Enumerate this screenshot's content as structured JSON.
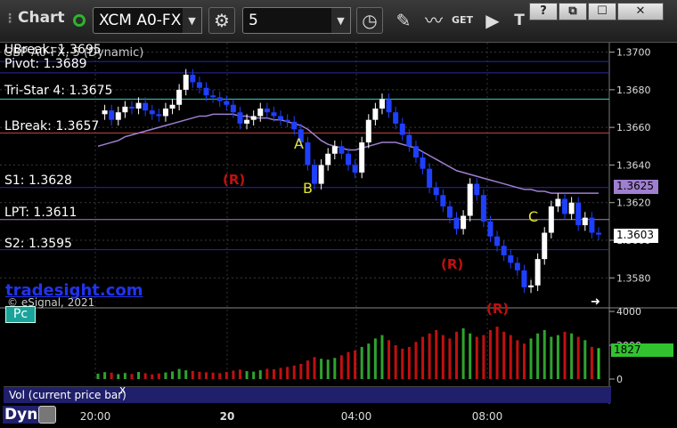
{
  "toolbar": {
    "title": "Chart",
    "symbol": "XCM A0-FX",
    "interval": "5",
    "get_label": "GET",
    "win_help": "?",
    "win_restore": "⧉",
    "win_max": "☐",
    "win_close": "✕",
    "icons": [
      "gear-icon",
      "clock-icon",
      "pencil-icon",
      "drawing-tools-icon",
      "get-data-icon",
      "play-icon",
      "text-tool-icon"
    ]
  },
  "chart": {
    "header_label": "GBP A0-FX, 5 (Dynamic)",
    "brand": "tradesight.com",
    "copyright": "© eSignal, 2021",
    "pc_label": "Pc",
    "vol_caption": "Vol (current price bar)",
    "vol_close": "x",
    "dyn_label": "Dyn",
    "colors": {
      "up_bar": "#ffffff",
      "down_bar": "#1f3fff",
      "ma": "#9f7fd0",
      "pivot_line": "#2a2aa0",
      "tristar_line": "#40d0c0",
      "lbreak_line": "#c04040",
      "vol_up": "#2ea42e",
      "vol_down": "#c01010",
      "vol_last": "#31c22f"
    }
  },
  "levels": [
    {
      "label": "UBreak: 1.3695",
      "value": 1.3695
    },
    {
      "label": "Pivot: 1.3689",
      "value": 1.3689
    },
    {
      "label": "Tri-Star 4: 1.3675",
      "value": 1.3675
    },
    {
      "label": "LBreak: 1.3657",
      "value": 1.3657
    },
    {
      "label": "S1: 1.3628",
      "value": 1.3628
    },
    {
      "label": "LPT: 1.3611",
      "value": 1.3611
    },
    {
      "label": "S2: 1.3595",
      "value": 1.3595
    }
  ],
  "markers": [
    {
      "label": "A",
      "time": "03:00",
      "price": 1.3652
    },
    {
      "label": "B",
      "time": "03:10",
      "price": 1.3625
    },
    {
      "label": "C",
      "time": "08:35",
      "price": 1.3617
    }
  ],
  "r_marks": [
    {
      "label": "(R)",
      "time": "01:15",
      "price": 1.363
    },
    {
      "label": "(R)",
      "time": "06:40",
      "price": 1.3592
    },
    {
      "label": "(R)",
      "time": "07:55",
      "price": 1.3561
    }
  ],
  "current_price": "1.3603",
  "ma_price": "1.3625",
  "current_volume": "1827",
  "chart_data": {
    "type": "line",
    "x_ticks": [
      "20:00",
      "20",
      "04:00",
      "08:00"
    ],
    "price_ticks": [
      "1.3700",
      "1.3680",
      "1.3660",
      "1.3640",
      "1.3620",
      "1.3600",
      "1.3580"
    ],
    "price_ylim": [
      1.3565,
      1.3705
    ],
    "volume_ticks": [
      "4000",
      "2000",
      "0"
    ],
    "volume_ylim": [
      0,
      4000
    ],
    "series": [
      {
        "values": [
          1.3667,
          1.3669,
          1.3664,
          1.3668,
          1.3671,
          1.367,
          1.3673,
          1.3669,
          1.3667,
          1.3666,
          1.367,
          1.3672,
          1.368,
          1.3688,
          1.3684,
          1.3681,
          1.3677,
          1.3676,
          1.3674,
          1.3672,
          1.3668,
          1.3662,
          1.3664,
          1.3666,
          1.367,
          1.3668,
          1.3666,
          1.3664,
          1.3663,
          1.3659,
          1.3652,
          1.364,
          1.363,
          1.364,
          1.3646,
          1.365,
          1.3646,
          1.364,
          1.3636,
          1.3652,
          1.3664,
          1.367,
          1.3675,
          1.3668,
          1.3662,
          1.3656,
          1.365,
          1.3644,
          1.3638,
          1.3628,
          1.3624,
          1.3618,
          1.3612,
          1.3606,
          1.3613,
          1.363,
          1.3624,
          1.361,
          1.3602,
          1.3597,
          1.3592,
          1.3588,
          1.3584,
          1.3575,
          1.3576,
          1.359,
          1.3604,
          1.3618,
          1.3622,
          1.3614,
          1.362,
          1.3608,
          1.3612,
          1.3604,
          1.3603
        ]
      },
      {
        "values": [
          1.365,
          1.3651,
          1.3652,
          1.3653,
          1.3655,
          1.3656,
          1.3657,
          1.3658,
          1.3659,
          1.366,
          1.3661,
          1.3662,
          1.3663,
          1.3664,
          1.3665,
          1.3666,
          1.3666,
          1.3667,
          1.3667,
          1.3667,
          1.3667,
          1.3666,
          1.3666,
          1.3665,
          1.3665,
          1.3665,
          1.3664,
          1.3664,
          1.3663,
          1.3662,
          1.3661,
          1.3659,
          1.3656,
          1.3653,
          1.3651,
          1.365,
          1.3649,
          1.3648,
          1.3648,
          1.3649,
          1.365,
          1.3651,
          1.3652,
          1.3652,
          1.3652,
          1.3651,
          1.365,
          1.3649,
          1.3647,
          1.3645,
          1.3643,
          1.3641,
          1.3639,
          1.3637,
          1.3636,
          1.3635,
          1.3634,
          1.3633,
          1.3632,
          1.3631,
          1.363,
          1.3629,
          1.3628,
          1.3627,
          1.3627,
          1.3626,
          1.3626,
          1.3625,
          1.3625,
          1.3625,
          1.3625,
          1.3625,
          1.3625,
          1.3625,
          1.3625
        ]
      }
    ],
    "volume": [
      320,
      410,
      380,
      290,
      360,
      300,
      420,
      350,
      280,
      330,
      390,
      450,
      600,
      520,
      480,
      430,
      400,
      380,
      350,
      420,
      500,
      560,
      470,
      440,
      520,
      610,
      580,
      660,
      720,
      800,
      900,
      1100,
      1300,
      1200,
      1150,
      1250,
      1400,
      1600,
      1700,
      1900,
      2100,
      2400,
      2600,
      2300,
      2000,
      1800,
      1900,
      2200,
      2500,
      2700,
      2900,
      2600,
      2400,
      2800,
      3000,
      2700,
      2500,
      2600,
      2900,
      3100,
      2800,
      2600,
      2300,
      2100,
      2400,
      2700,
      2900,
      2500,
      2600,
      2800,
      2700,
      2500,
      2300,
      1900,
      1827
    ]
  }
}
